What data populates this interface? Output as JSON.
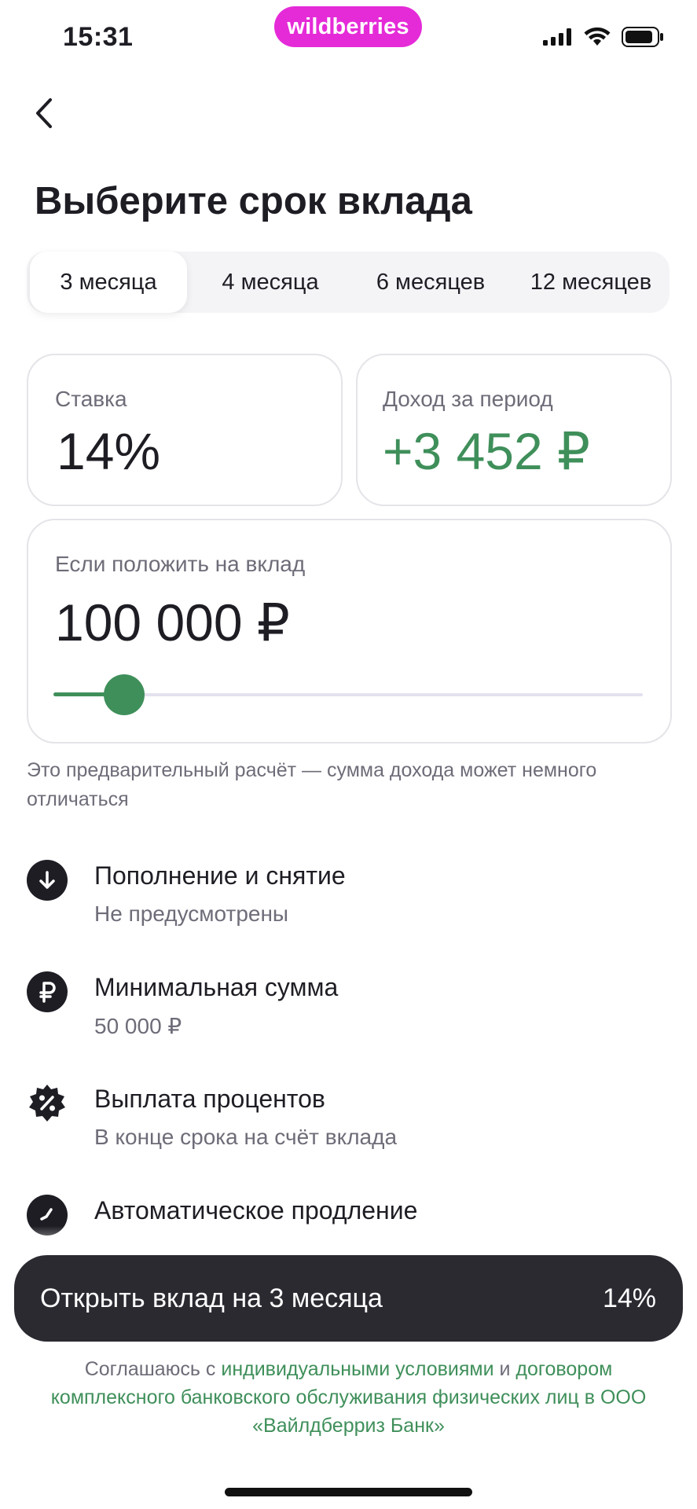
{
  "status_bar": {
    "time": "15:31",
    "brand": "wildberries",
    "icons": [
      "signal-icon",
      "wifi-icon",
      "battery-icon"
    ]
  },
  "header": {
    "back_icon": "chevron-left-icon",
    "title": "Выберите срок вклада"
  },
  "tabs": [
    {
      "label": "3 месяца",
      "selected": true
    },
    {
      "label": "4 месяца",
      "selected": false
    },
    {
      "label": "6 месяцев",
      "selected": false
    },
    {
      "label": "12 месяцев",
      "selected": false
    }
  ],
  "rate_card": {
    "label": "Ставка",
    "value": "14%"
  },
  "income_card": {
    "label": "Доход за период",
    "value": "+3 452 ₽"
  },
  "amount_card": {
    "label": "Если положить на вклад",
    "value": "100 000 ₽",
    "slider_fraction": 0.12
  },
  "note": "Это предварительный расчёт — сумма дохода может немного отличаться",
  "features": [
    {
      "icon": "arrow-down-icon",
      "title": "Пополнение и снятие",
      "subtitle": "Не предусмотрены"
    },
    {
      "icon": "ruble-icon",
      "title": "Минимальная сумма",
      "subtitle": "50 000 ₽"
    },
    {
      "icon": "percent-badge-icon",
      "title": "Выплата процентов",
      "subtitle": "В конце срока на счёт вклада"
    },
    {
      "icon": "clock-icon",
      "title": "Автоматическое продление",
      "subtitle": ""
    }
  ],
  "cta": {
    "label": "Открыть вклад на 3 месяца",
    "rate": "14%"
  },
  "consent": {
    "prefix": "Соглашаюсь с ",
    "link1": "индивидуальными условиями",
    "middle": " и ",
    "link2": "договором комплексного банковского обслуживания физических лиц в ООО «Вайлдберриз Банк»"
  },
  "colors": {
    "accent_green": "#3f8f5a",
    "brand_pink": "#e52bd8",
    "button_dark": "#2b2a31"
  }
}
